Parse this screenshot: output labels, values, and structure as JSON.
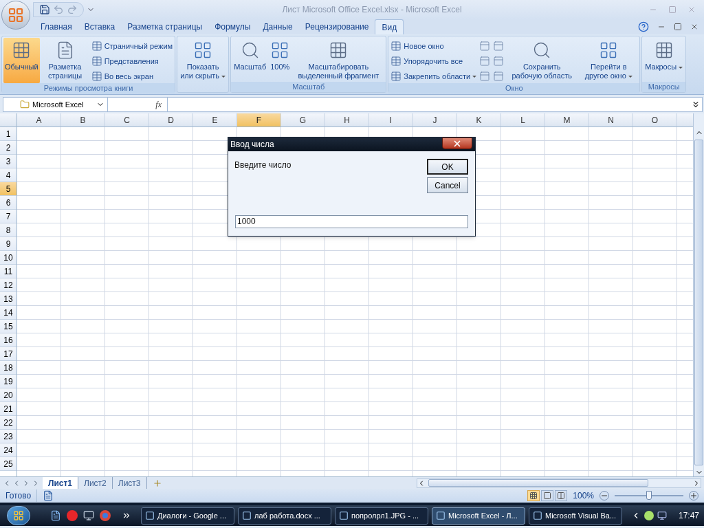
{
  "window": {
    "title": "Лист Microsoft Office Excel.xlsx - Microsoft Excel"
  },
  "ribbon_tabs": [
    {
      "label": "Главная",
      "selected": false
    },
    {
      "label": "Вставка",
      "selected": false
    },
    {
      "label": "Разметка страницы",
      "selected": false
    },
    {
      "label": "Формулы",
      "selected": false
    },
    {
      "label": "Данные",
      "selected": false
    },
    {
      "label": "Рецензирование",
      "selected": false
    },
    {
      "label": "Вид",
      "selected": true
    }
  ],
  "ribbon_groups": [
    {
      "label": "Режимы просмотра книги",
      "items": [
        {
          "kind": "large",
          "label": "Обычный",
          "selected": true,
          "dropdown": false
        },
        {
          "kind": "large",
          "label": "Разметка страницы",
          "selected": false,
          "dropdown": false
        },
        {
          "kind": "small",
          "label": "Страничный режим",
          "selected": false,
          "dropdown": false
        },
        {
          "kind": "small",
          "label": "Представления",
          "selected": false,
          "dropdown": false
        },
        {
          "kind": "small",
          "label": "Во весь экран",
          "selected": false,
          "dropdown": false
        }
      ]
    },
    {
      "items": [
        {
          "kind": "large",
          "label": "Показать или скрыть",
          "selected": false,
          "dropdown": true
        }
      ]
    },
    {
      "label": "Масштаб",
      "items": [
        {
          "kind": "large",
          "label": "Масштаб",
          "selected": false,
          "dropdown": false
        },
        {
          "kind": "large",
          "label": "100%",
          "selected": false,
          "dropdown": false
        },
        {
          "kind": "large",
          "label": "Масштабировать выделенный фрагмент",
          "selected": false,
          "dropdown": false
        }
      ]
    },
    {
      "label": "Окно",
      "items": [
        {
          "kind": "small",
          "label": "Новое окно",
          "selected": false,
          "dropdown": false
        },
        {
          "kind": "small",
          "label": "Упорядочить все",
          "selected": false,
          "dropdown": false
        },
        {
          "kind": "small",
          "label": "Закрепить области",
          "selected": false,
          "dropdown": true
        },
        {
          "kind": "icon",
          "selected": false,
          "dropdown": false
        },
        {
          "kind": "icon",
          "selected": false,
          "dropdown": false
        },
        {
          "kind": "icon",
          "selected": false,
          "dropdown": false
        },
        {
          "kind": "icon",
          "selected": false,
          "dropdown": false
        },
        {
          "kind": "icon",
          "selected": false,
          "dropdown": false
        },
        {
          "kind": "icon",
          "selected": false,
          "dropdown": false
        },
        {
          "kind": "large",
          "label": "Сохранить рабочую область",
          "selected": false,
          "dropdown": false
        },
        {
          "kind": "large",
          "label": "Перейти в другое окно",
          "selected": false,
          "dropdown": true
        }
      ]
    },
    {
      "label": "Макросы",
      "items": [
        {
          "kind": "large",
          "label": "Макросы",
          "selected": false,
          "dropdown": true
        }
      ]
    }
  ],
  "formula_bar": {
    "name_box": "Microsoft Excel",
    "function_label": "fx"
  },
  "sheet": {
    "columns": [
      {
        "label": "A",
        "selected": false
      },
      {
        "label": "B",
        "selected": false
      },
      {
        "label": "C",
        "selected": false
      },
      {
        "label": "D",
        "selected": false
      },
      {
        "label": "E",
        "selected": false
      },
      {
        "label": "F",
        "selected": true
      },
      {
        "label": "G",
        "selected": false
      },
      {
        "label": "H",
        "selected": false
      },
      {
        "label": "I",
        "selected": false
      },
      {
        "label": "J",
        "selected": false
      },
      {
        "label": "K",
        "selected": false
      },
      {
        "label": "L",
        "selected": false
      },
      {
        "label": "M",
        "selected": false
      },
      {
        "label": "N",
        "selected": false
      },
      {
        "label": "O",
        "selected": false
      }
    ],
    "rows": [
      {
        "label": "1",
        "selected": false
      },
      {
        "label": "2",
        "selected": false
      },
      {
        "label": "3",
        "selected": false
      },
      {
        "label": "4",
        "selected": false
      },
      {
        "label": "5",
        "selected": true
      },
      {
        "label": "6",
        "selected": false
      },
      {
        "label": "7",
        "selected": false
      },
      {
        "label": "8",
        "selected": false
      },
      {
        "label": "9",
        "selected": false
      },
      {
        "label": "10",
        "selected": false
      },
      {
        "label": "11",
        "selected": false
      },
      {
        "label": "12",
        "selected": false
      },
      {
        "label": "13",
        "selected": false
      },
      {
        "label": "14",
        "selected": false
      },
      {
        "label": "15",
        "selected": false
      },
      {
        "label": "16",
        "selected": false
      },
      {
        "label": "17",
        "selected": false
      },
      {
        "label": "18",
        "selected": false
      },
      {
        "label": "19",
        "selected": false
      },
      {
        "label": "20",
        "selected": false
      },
      {
        "label": "21",
        "selected": false
      },
      {
        "label": "22",
        "selected": false
      },
      {
        "label": "23",
        "selected": false
      },
      {
        "label": "24",
        "selected": false
      },
      {
        "label": "25",
        "selected": false
      }
    ]
  },
  "dialog": {
    "title": "Ввод числа",
    "prompt": "Введите число",
    "buttons": [
      {
        "label": "OK",
        "default": true
      },
      {
        "label": "Cancel",
        "default": false
      }
    ],
    "input": {
      "value": "1000"
    }
  },
  "sheet_tabs": [
    {
      "label": "Лист1",
      "selected": true
    },
    {
      "label": "Лист2",
      "selected": false
    },
    {
      "label": "Лист3",
      "selected": false
    }
  ],
  "status_bar": {
    "status": "Готово",
    "view_buttons": [
      {
        "selected": true
      },
      {
        "selected": false
      },
      {
        "selected": false
      }
    ],
    "zoom": "100%",
    "zoom_slider": {
      "level": 0.5
    }
  },
  "taskbar": {
    "tasks": [
      {
        "label": "Диалоги - Google ...",
        "selected": false
      },
      {
        "label": "лаб работа.docx ...",
        "selected": false
      },
      {
        "label": "попролрл1.JPG - ...",
        "selected": false
      },
      {
        "label": "Microsoft Excel - Л...",
        "selected": true
      },
      {
        "label": "Microsoft Visual Ba...",
        "selected": false
      }
    ],
    "clock": "17:47"
  }
}
